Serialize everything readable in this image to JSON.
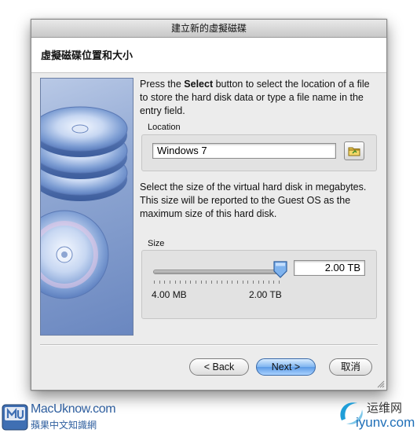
{
  "window": {
    "title": "建立新的虛擬磁碟",
    "header_title": "虛擬磁碟位置和大小"
  },
  "instructions": {
    "before_bold": "Press the ",
    "bold": "Select",
    "after_bold": " button to select the location of a file to store the hard disk data or type a file name in the entry field."
  },
  "location": {
    "label": "Location",
    "value": "Windows 7"
  },
  "size_description": "Select the size of the virtual hard disk in megabytes. This size will be reported to the Guest OS as the maximum size of this hard disk.",
  "size": {
    "label": "Size",
    "value": "2.00 TB",
    "min_label": "4.00 MB",
    "max_label": "2.00 TB",
    "slider_fraction": 1.0
  },
  "buttons": {
    "back": "< Back",
    "next": "Next >",
    "cancel": "取消"
  },
  "watermark_left": {
    "site": "MacUknow.com",
    "tagline": "蘋果中文知識網"
  },
  "watermark_right": {
    "cn": "运维网",
    "domain": "iyunv.com"
  },
  "colors": {
    "accent": "#5c9be6",
    "side_panel": "#8ea6d2"
  }
}
